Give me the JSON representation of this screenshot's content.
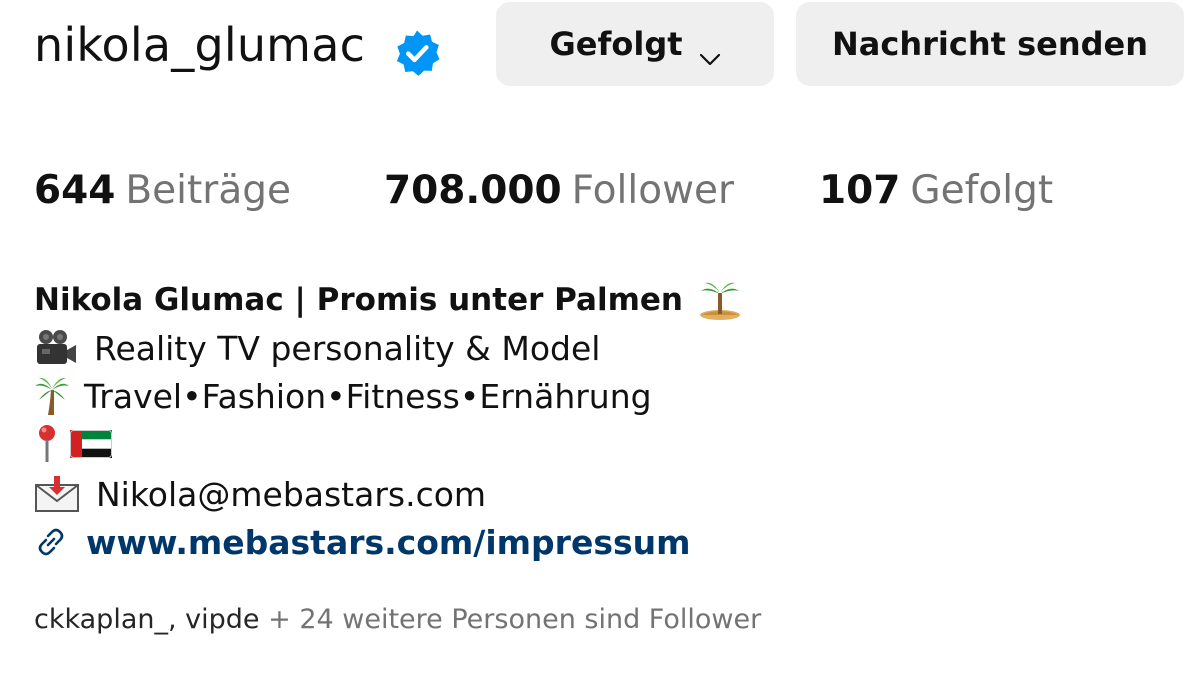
{
  "profile": {
    "username": "nikola_glumac",
    "verified_icon": "verified-badge-icon",
    "accent_color": "#0095f6"
  },
  "actions": {
    "following_label": "Gefolgt",
    "message_label": "Nachricht senden"
  },
  "stats": {
    "posts_count": "644",
    "posts_label": "Beiträge",
    "followers_count": "708.000",
    "followers_label": "Follower",
    "following_count": "107",
    "following_label": "Gefolgt"
  },
  "bio": {
    "name_line": "Nikola Glumac | Promis unter Palmen",
    "line2": "Reality TV personality & Model",
    "line3": "Travel•Fashion•Fitness•Ernährung",
    "line5": "Nikola@mebastars.com",
    "link": "www.mebastars.com/impressum",
    "link_color": "#00376b",
    "icons": [
      "desert-island-icon",
      "video-camera-icon",
      "palm-tree-icon",
      "pin-icon",
      "uae-flag-icon",
      "envelope-icon",
      "link-icon"
    ]
  },
  "followed_by": {
    "names": "ckkaplan_, vipde",
    "more": " + 24 weitere Personen sind Follower"
  }
}
